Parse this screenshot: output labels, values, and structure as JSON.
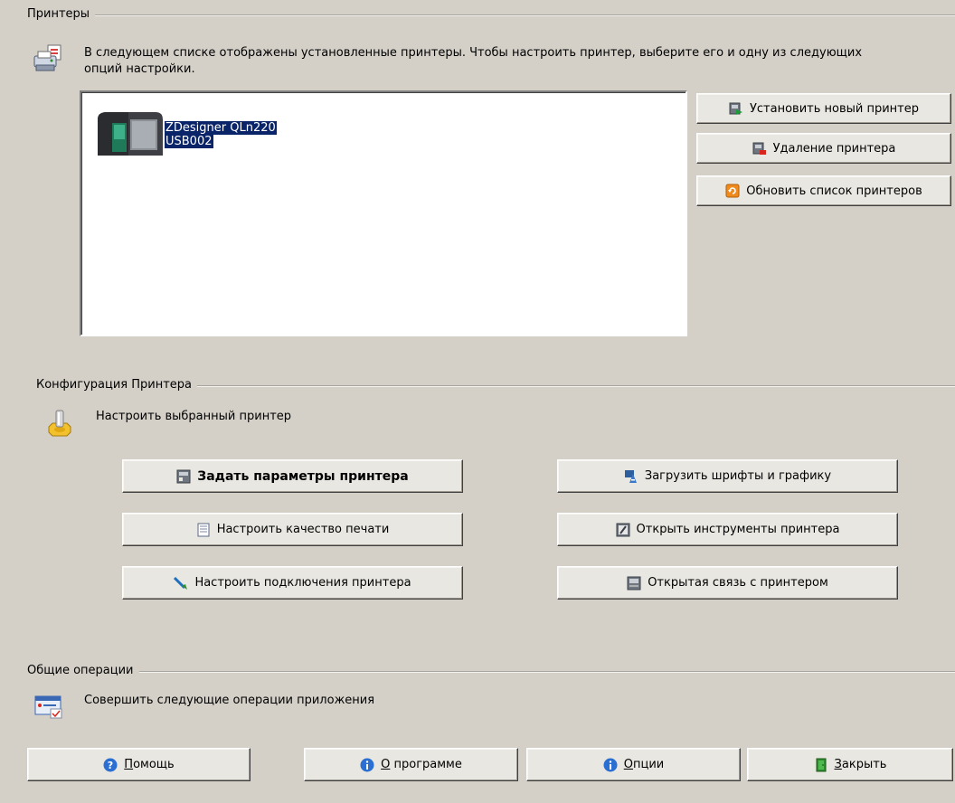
{
  "printers_section": {
    "title": "Принтеры",
    "description_line1": "В следующем списке отображены установленные принтеры. Чтобы настроить принтер, выберите его и одну из следующих",
    "description_line2": "опций настройки.",
    "printer_list": [
      {
        "name": "ZDesigner QLn220",
        "port": "USB002",
        "selected": true
      }
    ],
    "buttons": {
      "install": "Установить новый принтер",
      "remove": "Удаление принтера",
      "refresh": "Обновить список принтеров"
    }
  },
  "config_section": {
    "title": "Конфигурация Принтера",
    "description": "Настроить выбранный принтер",
    "buttons": {
      "set_params": "Задать параметры принтера",
      "print_quality": "Настроить качество печати",
      "connections": "Настроить подключения принтера",
      "fonts_graphics": "Загрузить шрифты и графику",
      "tools": "Открыть инструменты принтера",
      "communication": "Открытая связь с принтером"
    }
  },
  "general_section": {
    "title": "Общие операции",
    "description": "Совершить следующие операции приложения",
    "buttons": {
      "help_first": "П",
      "help_rest": "омощь",
      "about_first": "О",
      "about_rest": " программе",
      "options_first": "О",
      "options_rest": "пции",
      "close_first": "З",
      "close_rest": "акрыть"
    }
  },
  "colors": {
    "background": "#d4d0c8",
    "selection": "#0a246a",
    "button_face": "#e9e7e1"
  }
}
